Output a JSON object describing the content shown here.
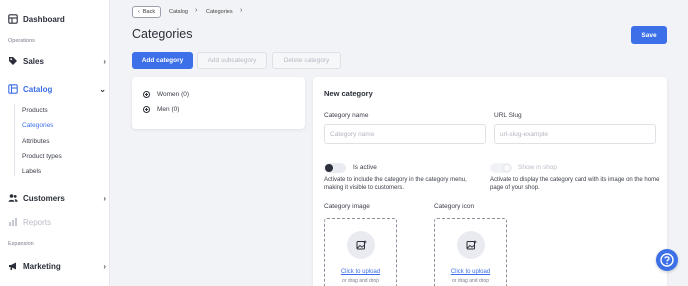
{
  "colors": {
    "accent": "#3d6fe8",
    "sidebar_bg": "#ffffff",
    "page_bg": "#f2f3f6"
  },
  "sidebar": {
    "dashboard": {
      "label": "Dashboard",
      "icon": "dashboard-icon"
    },
    "operations_label": "Operations",
    "sales": {
      "label": "Sales",
      "icon": "sales-tag-icon"
    },
    "catalog": {
      "label": "Catalog",
      "icon": "catalog-icon"
    },
    "catalog_items": [
      "Products",
      "Categories",
      "Attributes",
      "Product types",
      "Labels"
    ],
    "customers": {
      "label": "Customers",
      "icon": "users-icon"
    },
    "reports": {
      "label": "Reports",
      "icon": "reports-icon"
    },
    "expansion_label": "Expansion",
    "marketing": {
      "label": "Marketing",
      "icon": "megaphone-icon"
    }
  },
  "header": {
    "back_label": "Back",
    "breadcrumb": [
      "Catalog",
      "Categories"
    ],
    "title": "Categories",
    "save_label": "Save"
  },
  "actions": {
    "add_category": "Add category",
    "add_subcategory": "Add subcategory",
    "delete_category": "Delete category"
  },
  "tree": {
    "items": [
      {
        "label": "Women (0)"
      },
      {
        "label": "Men (0)"
      }
    ]
  },
  "form": {
    "title": "New category",
    "name_label": "Category name",
    "name_placeholder": "Category name",
    "name_value": "",
    "slug_label": "URL Slug",
    "slug_placeholder": "url-slug-example",
    "slug_value": "",
    "is_active_label": "Is active",
    "is_active_on": true,
    "is_active_hint": "Activate to include the category in the category menu, making it visible to customers.",
    "show_in_shop_label": "Show in shop",
    "show_in_shop_on": false,
    "show_in_shop_hint": "Activate to display the category card with its image on the home page of your shop.",
    "image_label": "Category image",
    "icon_label": "Category icon",
    "upload_link": "Click to upload",
    "upload_sub": "or drag and drop"
  },
  "help": {
    "icon": "help-icon"
  }
}
